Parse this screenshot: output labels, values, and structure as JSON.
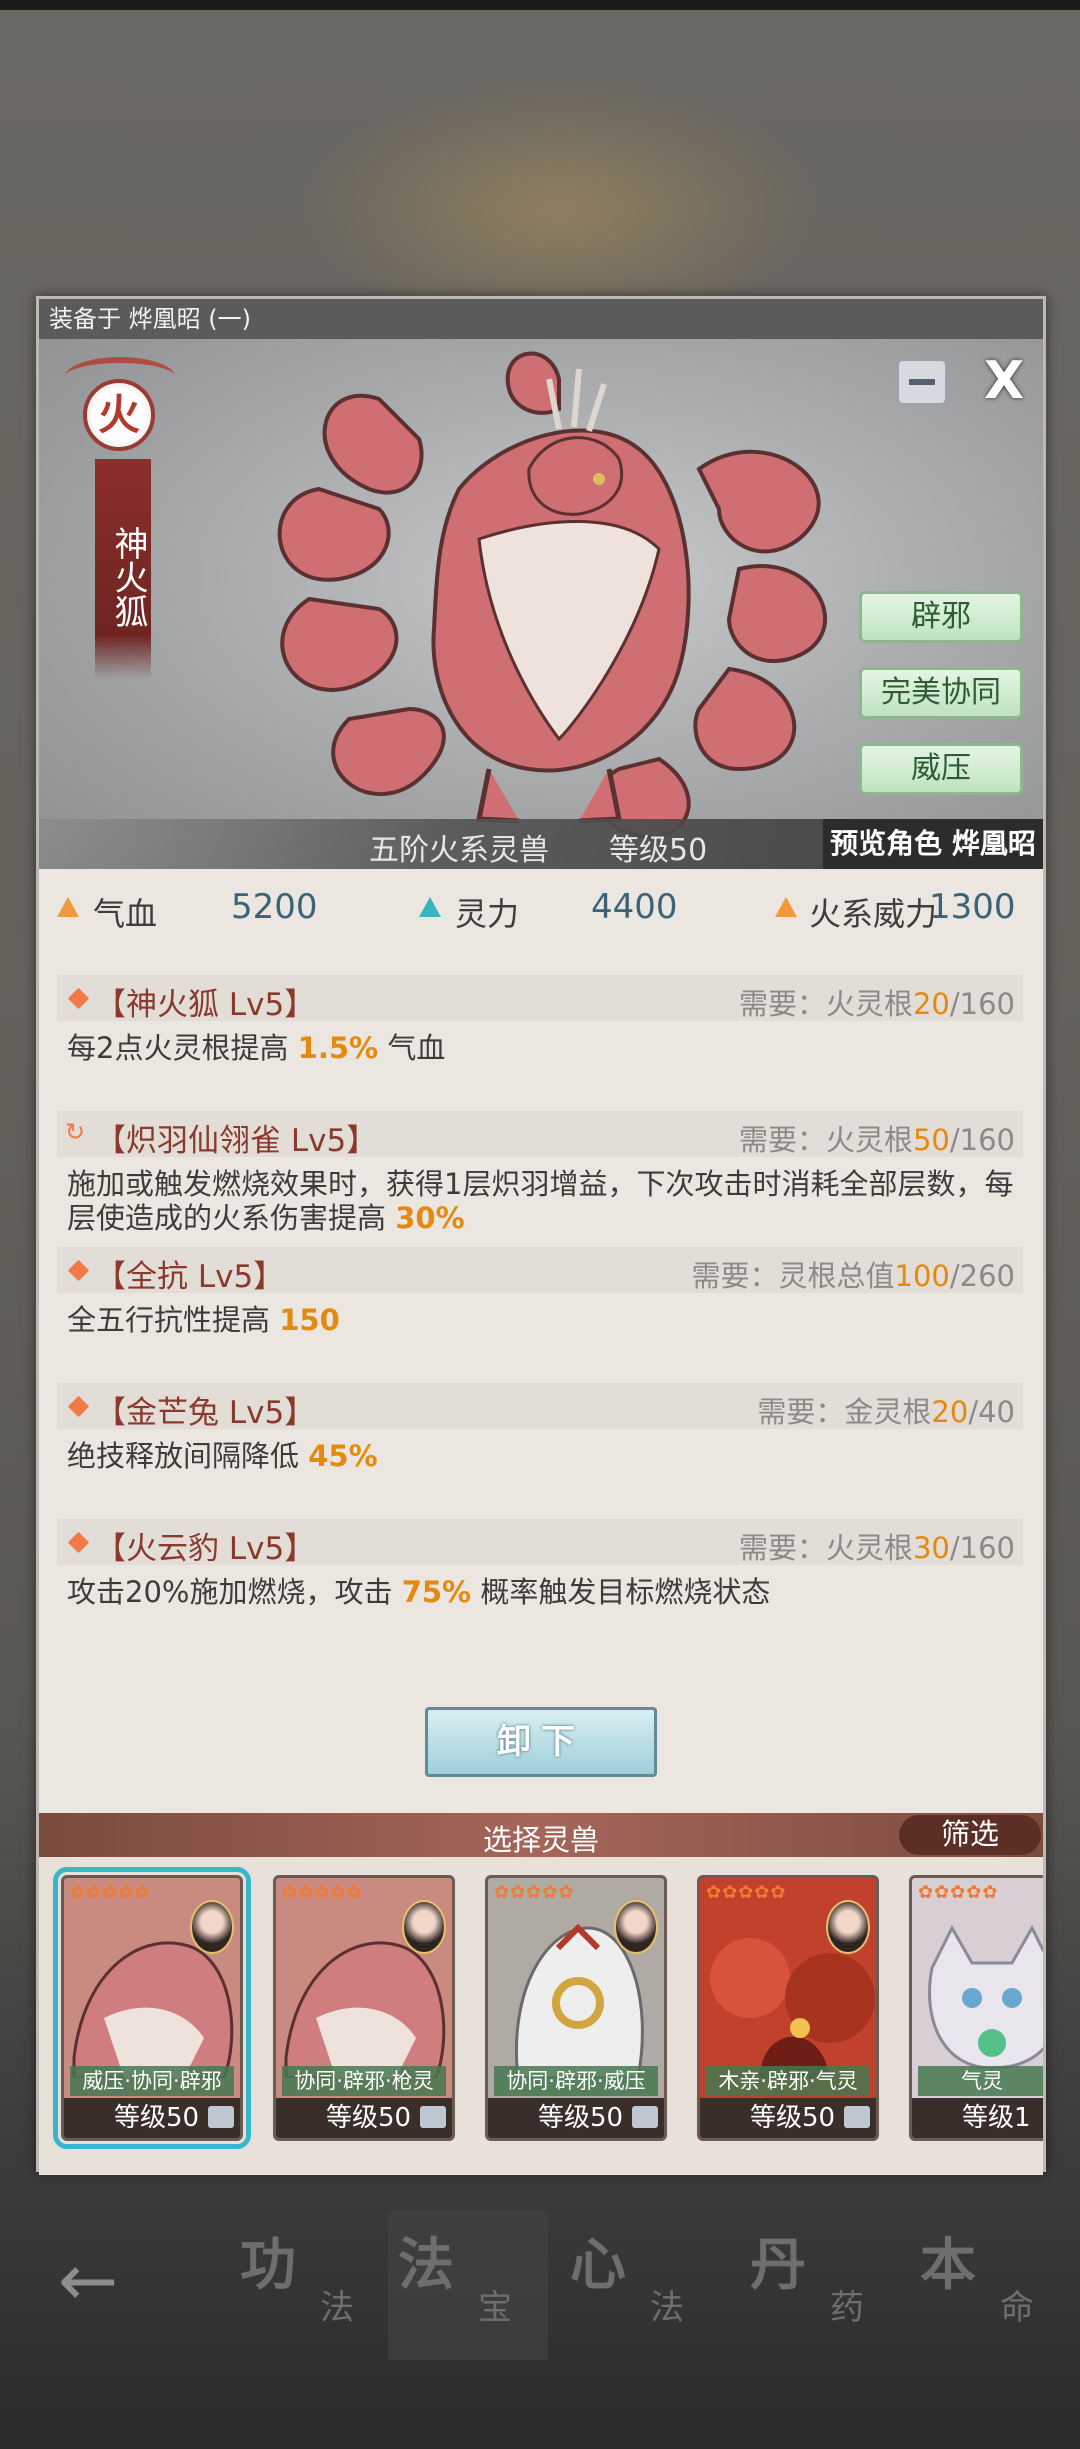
{
  "panel": {
    "equipped_label": "装备于 烨凰昭 (一)",
    "close": "X"
  },
  "beast": {
    "element": "火",
    "name": "神火狐",
    "traits": [
      "辟邪",
      "完美协同",
      "威压"
    ],
    "rank": "五阶火系灵兽",
    "level": "等级50",
    "preview": "预览角色 烨凰昭"
  },
  "stats": [
    {
      "label": "气血",
      "value": "5200",
      "color": "orange"
    },
    {
      "label": "灵力",
      "value": "4400",
      "color": "cyan"
    },
    {
      "label": "火系威力",
      "value": "1300",
      "color": "orange"
    }
  ],
  "skills": [
    {
      "name": "【神火狐 Lv5】",
      "req_label": "需要：",
      "req_type": "火灵根",
      "req_cur": "20",
      "req_max": "/160",
      "desc_pre": "每2点火灵根提高 ",
      "desc_hl": "1.5%",
      "desc_post": " 气血"
    },
    {
      "name": "【炽羽仙翎雀 Lv5】",
      "req_label": "需要：",
      "req_type": "火灵根",
      "req_cur": "50",
      "req_max": "/160",
      "desc_pre": "施加或触发燃烧效果时，获得1层炽羽增益，下次攻击时消耗全部层数，每层使造成的火系伤害提高 ",
      "desc_hl": "30%",
      "desc_post": ""
    },
    {
      "name": "【全抗 Lv5】",
      "req_label": "需要：",
      "req_type": "灵根总值",
      "req_cur": "100",
      "req_max": "/260",
      "desc_pre": "全五行抗性提高 ",
      "desc_hl": "150",
      "desc_post": ""
    },
    {
      "name": "【金芒兔 Lv5】",
      "req_label": "需要：",
      "req_type": "金灵根",
      "req_cur": "20",
      "req_max": "/40",
      "desc_pre": "绝技释放间隔降低 ",
      "desc_hl": "45%",
      "desc_post": ""
    },
    {
      "name": "【火云豹 Lv5】",
      "req_label": "需要：",
      "req_type": "火灵根",
      "req_cur": "30",
      "req_max": "/160",
      "desc_pre": "攻击20%施加燃烧，攻击 ",
      "desc_hl": "75%",
      "desc_post": " 概率触发目标燃烧状态"
    }
  ],
  "unequip_label": "卸下",
  "select": {
    "title": "选择灵兽",
    "filter": "筛选",
    "cards": [
      {
        "traits": "威压·协同·辟邪",
        "level": "等级50",
        "stars": "✿✿✿✿✿"
      },
      {
        "traits": "协同·辟邪·枪灵",
        "level": "等级50",
        "stars": "✿✿✿✿✿"
      },
      {
        "traits": "协同·辟邪·威压",
        "level": "等级50",
        "stars": "✿✿✿✿✿"
      },
      {
        "traits": "木亲·辟邪·气灵",
        "level": "等级50",
        "stars": "✿✿✿✿✿"
      },
      {
        "traits": "气灵",
        "level": "等级1",
        "stars": "✿✿✿✿✿"
      }
    ]
  },
  "nav": [
    {
      "big": "功",
      "small": "法"
    },
    {
      "big": "法",
      "small": "宝"
    },
    {
      "big": "心",
      "small": "法"
    },
    {
      "big": "丹",
      "small": "药"
    },
    {
      "big": "本",
      "small": "命"
    }
  ],
  "icons": {
    "back": "arrow-left-icon",
    "bag": "bag-icon",
    "close": "close-icon"
  }
}
